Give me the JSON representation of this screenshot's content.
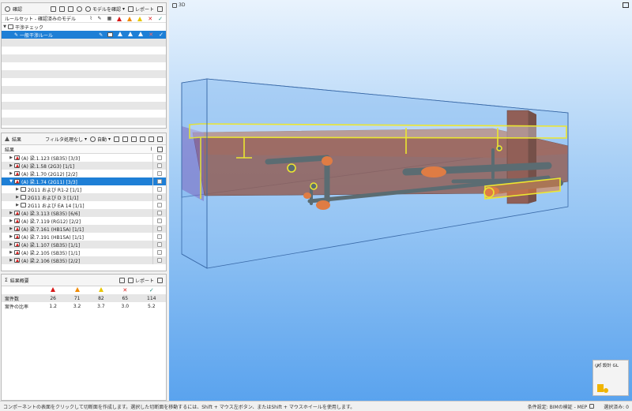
{
  "panel_check": {
    "title": "確認",
    "model_btn": "モデルを確認",
    "report_btn": "レポート",
    "column_label": "ルールセット - 確認済みのモデル",
    "rows": [
      {
        "label": "干渉チェック",
        "level": 0,
        "expanded": true
      },
      {
        "label": "一般干渉ルール",
        "level": 1,
        "selected": true
      }
    ]
  },
  "panel_results": {
    "title": "結果",
    "filter_btn": "フィルタ処理なし",
    "auto_btn": "自動",
    "column_label": "結果",
    "rows": [
      {
        "label": "(A) 梁.1.123 (SB35) [3/3]",
        "level": 1,
        "arrow": "▶"
      },
      {
        "label": "(A) 梁.1.58 (2G3) [1/1]",
        "level": 1,
        "arrow": "▶"
      },
      {
        "label": "(A) 梁.1.70 (2G12) [2/2]",
        "level": 1,
        "arrow": "▶"
      },
      {
        "label": "(A) 梁.1.74 (2G11) [3/3]",
        "level": 1,
        "arrow": "▼",
        "selected": true
      },
      {
        "label": "2G11 および R1-2 [1/1]",
        "level": 2,
        "arrow": "▶"
      },
      {
        "label": "2G11 および D 3 [1/1]",
        "level": 2,
        "arrow": "▶"
      },
      {
        "label": "2G11 および EA 14 [1/1]",
        "level": 2,
        "arrow": "▶"
      },
      {
        "label": "(A) 梁.3.113 (SB35) [6/6]",
        "level": 1,
        "arrow": "▶"
      },
      {
        "label": "(A) 梁.7.119 (RG12) [2/2]",
        "level": 1,
        "arrow": "▶"
      },
      {
        "label": "(A) 梁.7.161 (HB15A) [1/1]",
        "level": 1,
        "arrow": "▶"
      },
      {
        "label": "(A) 梁.7.191 (HB15A) [1/1]",
        "level": 1,
        "arrow": "▶"
      },
      {
        "label": "(A) 梁.1.107 (SB35) [1/1]",
        "level": 1,
        "arrow": "▶"
      },
      {
        "label": "(A) 梁.2.105 (SB35) [1/1]",
        "level": 1,
        "arrow": "▶"
      },
      {
        "label": "(A) 梁.2.106 (SB35) [2/2]",
        "level": 1,
        "arrow": "▶"
      }
    ]
  },
  "panel_summary": {
    "title": "結果概要",
    "report_btn": "レポート",
    "rows": [
      {
        "label": "案件数",
        "values": [
          "26",
          "71",
          "82",
          "65",
          "114"
        ]
      },
      {
        "label": "案件の比率",
        "values": [
          "1.2",
          "3.2",
          "3.7",
          "3.0",
          "5.2"
        ]
      }
    ]
  },
  "viewport": {
    "title": "3D",
    "minimap_title": "(A) 設計 GL"
  },
  "statusbar": {
    "message": "コンポーネントの表面をクリックして切断面を作成します。選択した切断面を移動するには、Shift + マウス左ボタン、またはShift + マウスホイールを使用します。",
    "condition": "条件設定: BIMの検証 - MEP",
    "selection": "選択済み: 0"
  },
  "colors": {
    "selection": "#1e7fd6",
    "critical": "#d81818",
    "major": "#f08a00",
    "minor": "#e8c600",
    "ok": "#1c8a7c",
    "beam": "#8f4530",
    "pipe": "#4c5652",
    "highlight": "#ffee00"
  }
}
